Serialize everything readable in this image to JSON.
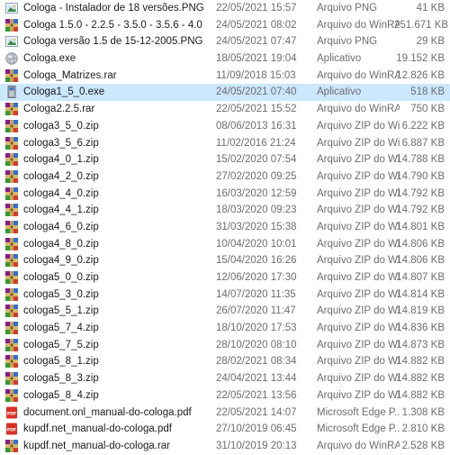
{
  "files": [
    {
      "name": "Cologa - Instalador de 18 versões.PNG",
      "date": "22/05/2021 15:57",
      "type": "Arquivo PNG",
      "size": "41 KB",
      "icon": "image-file-icon"
    },
    {
      "name": "Cologa 1.5.0 - 2.2.5 - 3.5.0 - 3.5.6 - 4.0.1 - ...",
      "date": "24/05/2021 08:02",
      "type": "Arquivo do WinRAR",
      "size": "251.671 KB",
      "icon": "winrar-archive-icon"
    },
    {
      "name": "Cologa versão 1.5 de 15-12-2005.PNG",
      "date": "24/05/2021 07:47",
      "type": "Arquivo PNG",
      "size": "29 KB",
      "icon": "image-file-icon"
    },
    {
      "name": "Cologa.exe",
      "date": "18/05/2021 19:04",
      "type": "Aplicativo",
      "size": "19.152 KB",
      "icon": "app-globe-icon"
    },
    {
      "name": "Cologa_Matrizes.rar",
      "date": "11/09/2018 15:03",
      "type": "Arquivo do WinRAR",
      "size": "12.826 KB",
      "icon": "winrar-archive-icon"
    },
    {
      "name": "Cologa1_5_0.exe",
      "date": "24/05/2021 07:40",
      "type": "Aplicativo",
      "size": "518 KB",
      "icon": "installer-icon"
    },
    {
      "name": "Cologa2.2.5.rar",
      "date": "22/05/2021 15:52",
      "type": "Arquivo do WinRAR",
      "size": "750 KB",
      "icon": "winrar-archive-icon"
    },
    {
      "name": "cologa3_5_0.zip",
      "date": "08/06/2013 16:31",
      "type": "Arquivo ZIP do Wi...",
      "size": "6.222 KB",
      "icon": "winrar-archive-icon"
    },
    {
      "name": "cologa3_5_6.zip",
      "date": "11/02/2016 21:24",
      "type": "Arquivo ZIP do Wi...",
      "size": "6.887 KB",
      "icon": "winrar-archive-icon"
    },
    {
      "name": "cologa4_0_1.zip",
      "date": "15/02/2020 07:54",
      "type": "Arquivo ZIP do Wi...",
      "size": "14.788 KB",
      "icon": "winrar-archive-icon"
    },
    {
      "name": "cologa4_2_0.zip",
      "date": "27/02/2020 09:25",
      "type": "Arquivo ZIP do Wi...",
      "size": "14.790 KB",
      "icon": "winrar-archive-icon"
    },
    {
      "name": "cologa4_4_0.zip",
      "date": "16/03/2020 12:59",
      "type": "Arquivo ZIP do Wi...",
      "size": "14.792 KB",
      "icon": "winrar-archive-icon"
    },
    {
      "name": "cologa4_4_1.zip",
      "date": "18/03/2020 09:23",
      "type": "Arquivo ZIP do Wi...",
      "size": "14.792 KB",
      "icon": "winrar-archive-icon"
    },
    {
      "name": "cologa4_6_0.zip",
      "date": "31/03/2020 15:38",
      "type": "Arquivo ZIP do Wi...",
      "size": "14.801 KB",
      "icon": "winrar-archive-icon"
    },
    {
      "name": "cologa4_8_0.zip",
      "date": "10/04/2020 10:01",
      "type": "Arquivo ZIP do Wi...",
      "size": "14.806 KB",
      "icon": "winrar-archive-icon"
    },
    {
      "name": "cologa4_9_0.zip",
      "date": "15/04/2020 16:26",
      "type": "Arquivo ZIP do Wi...",
      "size": "14.806 KB",
      "icon": "winrar-archive-icon"
    },
    {
      "name": "cologa5_0_0.zip",
      "date": "12/06/2020 17:30",
      "type": "Arquivo ZIP do Wi...",
      "size": "14.807 KB",
      "icon": "winrar-archive-icon"
    },
    {
      "name": "cologa5_3_0.zip",
      "date": "14/07/2020 11:35",
      "type": "Arquivo ZIP do Wi...",
      "size": "14.814 KB",
      "icon": "winrar-archive-icon"
    },
    {
      "name": "cologa5_5_1.zip",
      "date": "26/07/2020 11:47",
      "type": "Arquivo ZIP do Wi...",
      "size": "14.819 KB",
      "icon": "winrar-archive-icon"
    },
    {
      "name": "cologa5_7_4.zip",
      "date": "18/10/2020 17:53",
      "type": "Arquivo ZIP do Wi...",
      "size": "14.836 KB",
      "icon": "winrar-archive-icon"
    },
    {
      "name": "cologa5_7_5.zip",
      "date": "28/10/2020 08:10",
      "type": "Arquivo ZIP do Wi...",
      "size": "14.873 KB",
      "icon": "winrar-archive-icon"
    },
    {
      "name": "cologa5_8_1.zip",
      "date": "28/02/2021 08:34",
      "type": "Arquivo ZIP do Wi...",
      "size": "14.882 KB",
      "icon": "winrar-archive-icon"
    },
    {
      "name": "cologa5_8_3.zip",
      "date": "24/04/2021 13:44",
      "type": "Arquivo ZIP do Wi...",
      "size": "14.882 KB",
      "icon": "winrar-archive-icon"
    },
    {
      "name": "cologa5_8_4.zip",
      "date": "22/05/2021 13:56",
      "type": "Arquivo ZIP do Wi...",
      "size": "14.882 KB",
      "icon": "winrar-archive-icon"
    },
    {
      "name": "document.onl_manual-do-cologa.pdf",
      "date": "22/05/2021 14:07",
      "type": "Microsoft Edge P...",
      "size": "1.308 KB",
      "icon": "pdf-file-icon"
    },
    {
      "name": "kupdf.net_manual-do-cologa.pdf",
      "date": "27/10/2019 06:45",
      "type": "Microsoft Edge P...",
      "size": "2.810 KB",
      "icon": "pdf-file-icon"
    },
    {
      "name": "kupdf.net_manual-do-cologa.rar",
      "date": "31/10/2019 20:13",
      "type": "Arquivo do WinRAR",
      "size": "2.528 KB",
      "icon": "winrar-archive-icon"
    }
  ],
  "selected_name": "Cologa1_5_0.exe"
}
